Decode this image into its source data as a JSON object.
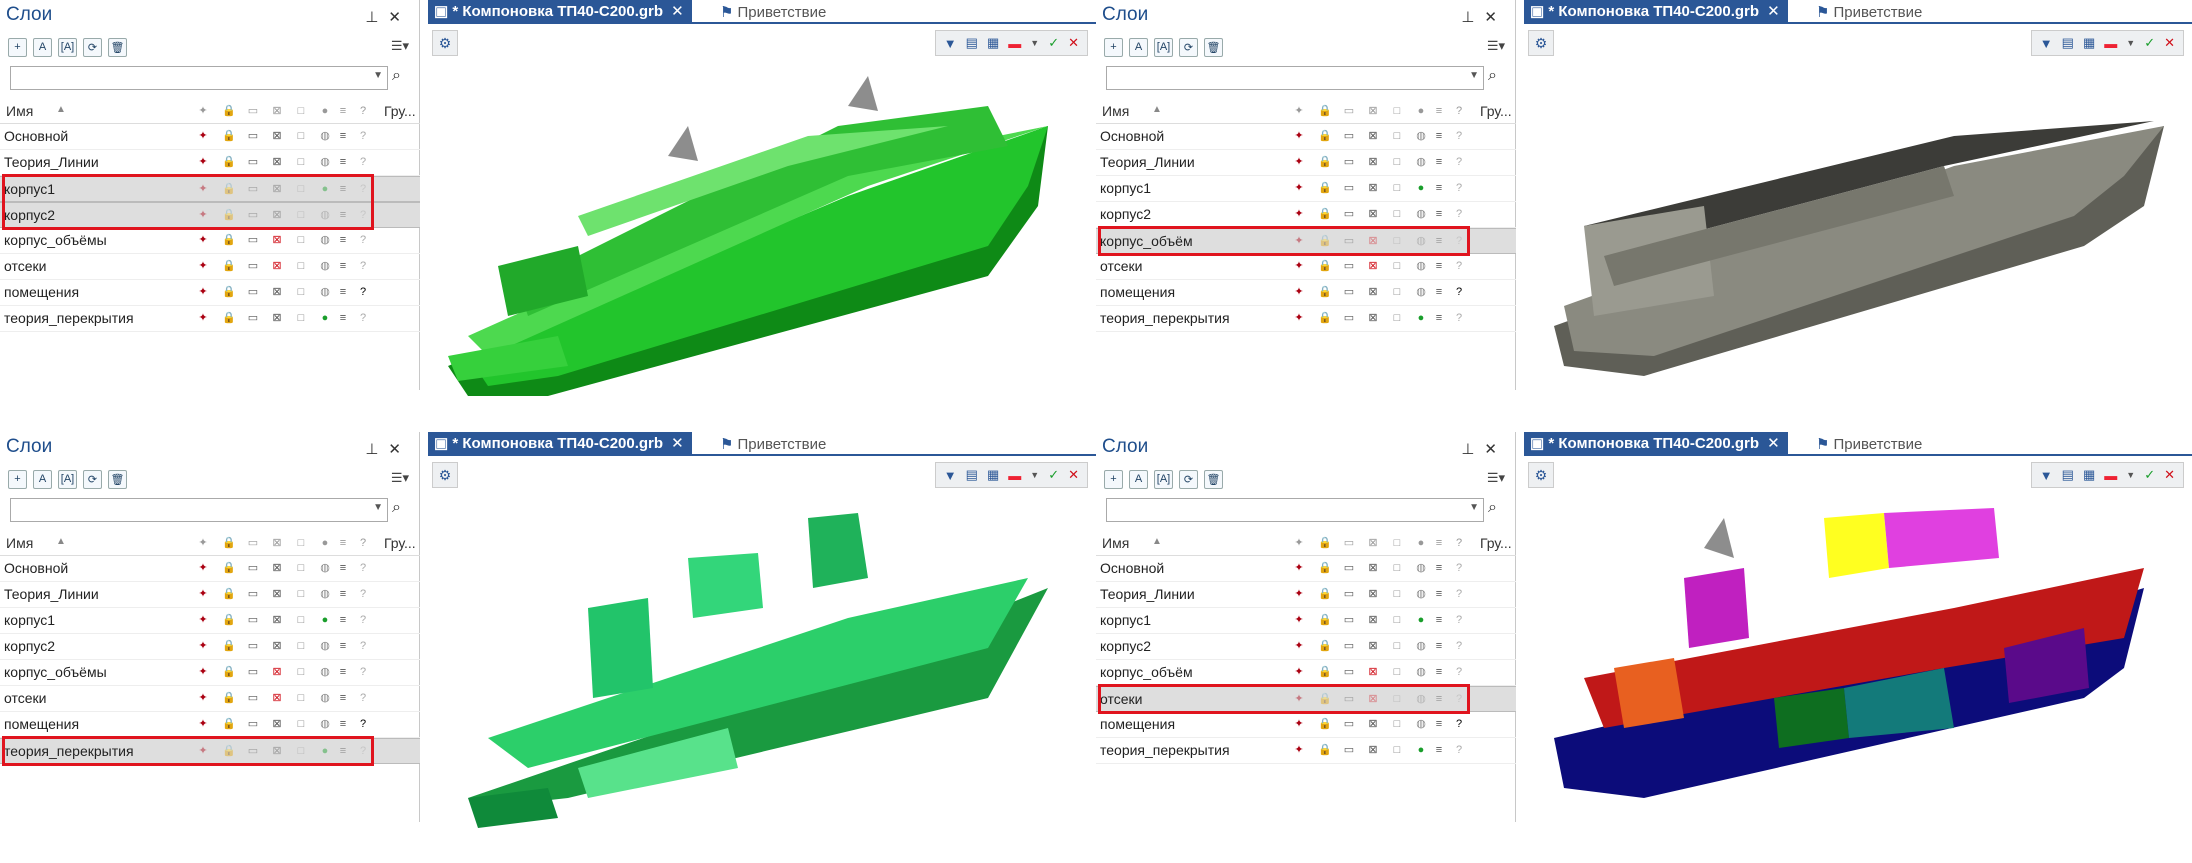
{
  "layers_panel": {
    "title": "Слои",
    "pin_icon": "pin-icon",
    "close_icon": "close-icon",
    "header": {
      "name": "Имя",
      "group": "Гру...",
      "question": "?"
    },
    "rows": [
      "Основной",
      "Теория_Линии",
      "корпус1",
      "корпус2",
      "корпус_объёмы",
      "отсеки",
      "помещения",
      "теория_перекрытия"
    ],
    "rows_alt": [
      "Основной",
      "Теория_Линии",
      "корпус1",
      "корпус2",
      "корпус_объём",
      "отсеки",
      "помещения",
      "теория_перекрытия"
    ]
  },
  "tabs": {
    "active": "* Компоновка ТП40-С200.grb",
    "close": "✕",
    "welcome": "Приветствие"
  },
  "quadrants": [
    {
      "selected": [
        2,
        3
      ],
      "model": "green-hull"
    },
    {
      "selected": [
        4
      ],
      "model": "gray-volumes"
    },
    {
      "selected": [
        7
      ],
      "model": "green-decks"
    },
    {
      "selected": [
        5
      ],
      "model": "colored-compartments"
    }
  ],
  "colors": {
    "accent": "#2b5797",
    "highlight": "#e0141e",
    "hull_green": "#1fb52a",
    "hull_gray": "#7d7d74"
  }
}
